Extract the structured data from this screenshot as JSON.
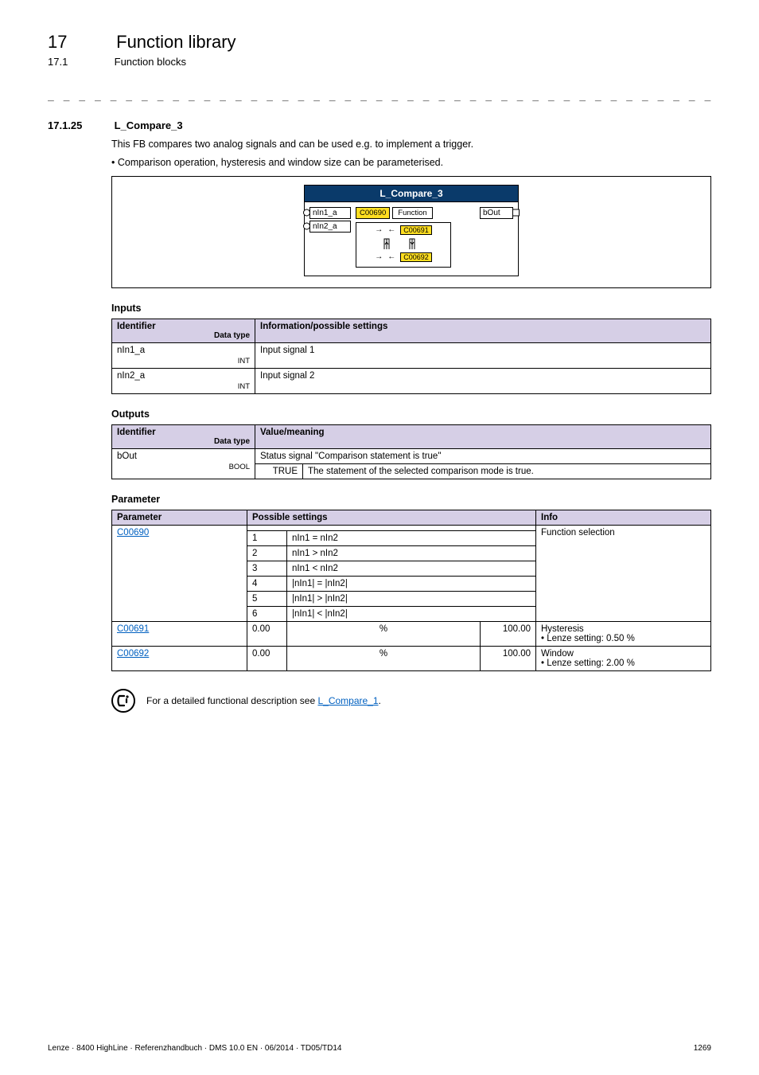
{
  "header": {
    "chapter_num": "17",
    "chapter_title": "Function library",
    "sub_num": "17.1",
    "sub_title": "Function blocks"
  },
  "section": {
    "num": "17.1.25",
    "title": "L_Compare_3",
    "intro": "This FB compares two analog signals and can be used e.g. to implement a trigger.",
    "bullet1": "Comparison operation, hysteresis and window size can be parameterised."
  },
  "diagram": {
    "block_title": "L_Compare_3",
    "in1": "nIn1_a",
    "in2": "nIn2_a",
    "out": "bOut",
    "code_func": "C00690",
    "func_label": "Function",
    "code_hyst": "C00691",
    "code_win": "C00692"
  },
  "inputs": {
    "heading": "Inputs",
    "h1": "Identifier",
    "h1_sub": "Data type",
    "h2": "Information/possible settings",
    "rows": [
      {
        "id": "nIn1_a",
        "dtype": "INT",
        "desc": "Input signal 1"
      },
      {
        "id": "nIn2_a",
        "dtype": "INT",
        "desc": "Input signal 2"
      }
    ]
  },
  "outputs": {
    "heading": "Outputs",
    "h1": "Identifier",
    "h1_sub": "Data type",
    "h2": "Value/meaning",
    "row": {
      "id": "bOut",
      "dtype": "BOOL",
      "desc": "Status signal \"Comparison statement is true\"",
      "val": "TRUE",
      "valdesc": "The statement of the selected comparison mode is true."
    }
  },
  "params": {
    "heading": "Parameter",
    "h1": "Parameter",
    "h2": "Possible settings",
    "h3": "Info",
    "p1": {
      "code": "C00690",
      "info": "Function selection",
      "opts": [
        {
          "n": "1",
          "t": "nIn1 = nIn2"
        },
        {
          "n": "2",
          "t": "nIn1 > nIn2"
        },
        {
          "n": "3",
          "t": "nIn1 < nIn2"
        },
        {
          "n": "4",
          "t": "|nIn1| = |nIn2|"
        },
        {
          "n": "5",
          "t": "|nIn1| > |nIn2|"
        },
        {
          "n": "6",
          "t": "|nIn1| < |nIn2|"
        }
      ]
    },
    "p2": {
      "code": "C00691",
      "min": "0.00",
      "unit": "%",
      "max": "100.00",
      "info1": "Hysteresis",
      "info2": "• Lenze setting: 0.50 %"
    },
    "p3": {
      "code": "C00692",
      "min": "0.00",
      "unit": "%",
      "max": "100.00",
      "info1": "Window",
      "info2": "• Lenze setting: 2.00 %"
    }
  },
  "tip": {
    "text_pre": "For a detailed functional description see ",
    "link": "L_Compare_1",
    "text_post": "."
  },
  "footer": {
    "left": "Lenze · 8400 HighLine · Referenzhandbuch · DMS 10.0 EN · 06/2014 · TD05/TD14",
    "right": "1269"
  }
}
